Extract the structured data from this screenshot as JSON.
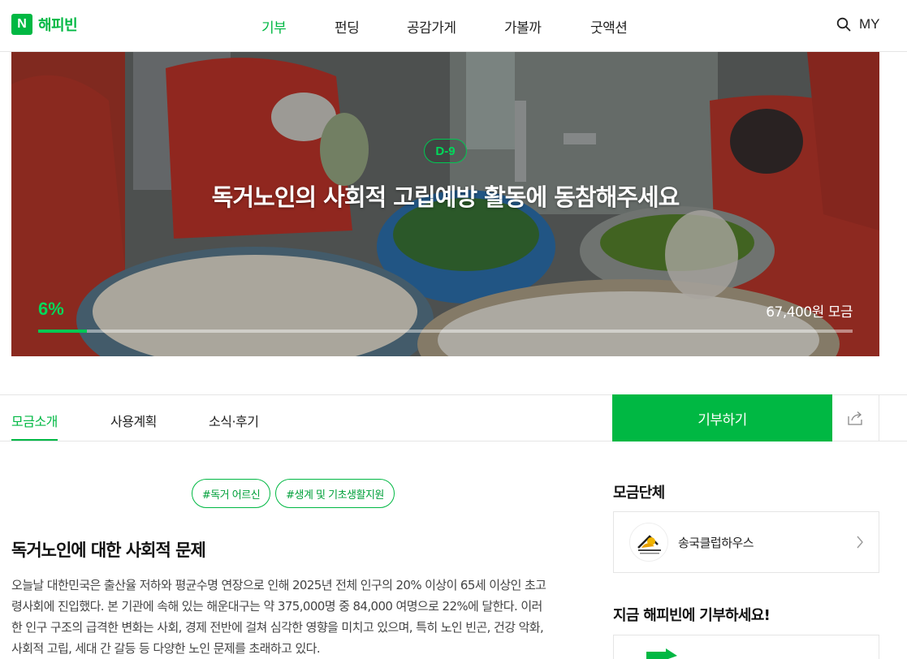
{
  "header": {
    "logo_mark": "N",
    "logo_text": "해피빈",
    "nav": [
      "기부",
      "펀딩",
      "공감가게",
      "가볼까",
      "굿액션"
    ],
    "my_label": "MY"
  },
  "hero": {
    "dday": "D-9",
    "title": "독거노인의 사회적 고립예방 활동에 동참해주세요",
    "percent_label": "6%",
    "progress_fraction": 0.06,
    "amount_label": "67,400원 모금"
  },
  "tabs": [
    "모금소개",
    "사용계획",
    "소식·후기"
  ],
  "donate_label": "기부하기",
  "tags": [
    "#독거 어르신",
    "#생계 및 기초생활지원"
  ],
  "content": {
    "section_title": "독거노인에 대한 사회적 문제",
    "lines": [
      "오늘날 대한민국은 출산율 저하와 평균수명 연장으로 인해 2025년 전체 인구의 20% 이상이 65세 이상인 초고",
      "령사회에 진입했다. 본 기관에 속해 있는 해운대구는 약 375,000명 중 84,000 여명으로 22%에 달한다. 이러",
      "한 인구 구조의 급격한 변화는 사회, 경제 전반에 걸쳐 심각한 영향을 미치고 있으며, 특히 노인 빈곤, 건강 악화,",
      "사회적 고립, 세대 간 갈등 등 다양한 노인 문제를 초래하고 있다."
    ]
  },
  "side": {
    "org_heading": "모금단체",
    "org_name": "송국클럽하우스",
    "promo_heading": "지금 해피빈에 기부하세요!"
  },
  "colors": {
    "brand_green": "#00b843"
  }
}
